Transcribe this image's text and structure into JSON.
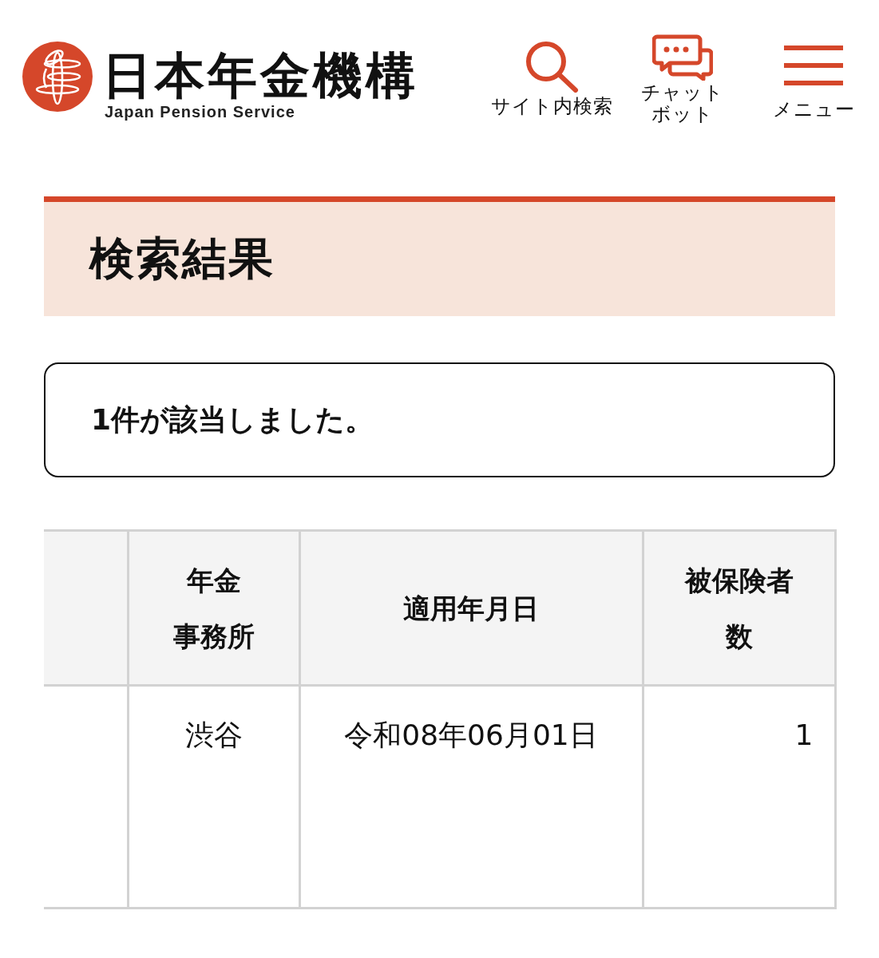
{
  "header": {
    "logo": {
      "name": "日本年金機構",
      "subtitle": "Japan Pension Service"
    },
    "nav": [
      {
        "kind": "search",
        "label": "サイト内検索"
      },
      {
        "kind": "chat",
        "label": "チャットボット"
      },
      {
        "kind": "menu",
        "label": "メニュー"
      }
    ]
  },
  "page_title": "検索結果",
  "result_message": "1件が該当しました。",
  "table": {
    "columns": [
      {
        "kind": "text",
        "label": "年金事務所"
      },
      {
        "kind": "date",
        "label": "適用年月日"
      },
      {
        "kind": "number",
        "label": "被保険者数"
      }
    ],
    "rows": [
      {
        "cells": [
          "渋谷",
          "令和08年06月01日",
          "1"
        ]
      }
    ]
  }
}
